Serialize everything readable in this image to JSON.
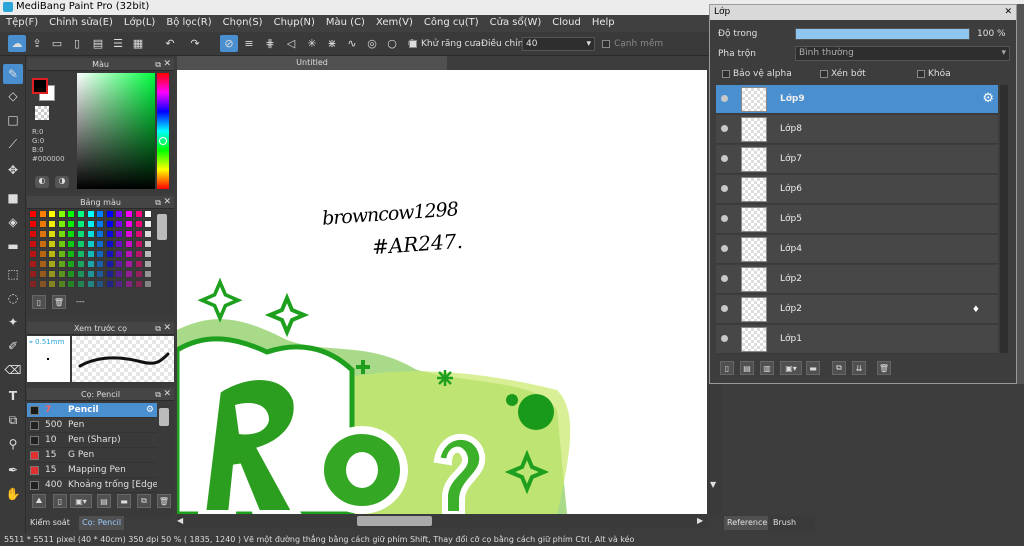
{
  "window": {
    "title": "MediBang Paint Pro (32bit)"
  },
  "menu": [
    "Tệp(F)",
    "Chỉnh sửa(E)",
    "Lớp(L)",
    "Bộ lọc(R)",
    "Chọn(S)",
    "Chụp(N)",
    "Màu (C)",
    "Xem(V)",
    "Công cụ(T)",
    "Cửa sổ(W)",
    "Cloud",
    "Help"
  ],
  "toolbar": {
    "antialias_label": "Khử răng cưa",
    "adjust_label": "Điều chỉnh",
    "adjust_value": "40",
    "snap_label": "Cạnh mềm"
  },
  "color_panel": {
    "title": "Màu",
    "r": "R:0",
    "g": "G:0",
    "b": "B:0",
    "hex": "#000000"
  },
  "palette_panel": {
    "title": "Bảng màu",
    "footer": "---"
  },
  "preview_panel": {
    "title": "Xem trước cọ",
    "size": "0.51mm"
  },
  "brush_panel": {
    "title": "Cọ: Pencil",
    "brushes": [
      {
        "size": "7",
        "name": "Pencil",
        "color": "#1a1a1a",
        "selected": true
      },
      {
        "size": "500",
        "name": "Pen",
        "color": "#222222"
      },
      {
        "size": "10",
        "name": "Pen (Sharp)",
        "color": "#222222"
      },
      {
        "size": "15",
        "name": "G Pen",
        "color": "#e03030"
      },
      {
        "size": "15",
        "name": "Mapping Pen",
        "color": "#e03030"
      },
      {
        "size": "400",
        "name": "Khoảng trống [Edge ]",
        "color": "#222222"
      }
    ],
    "tab1": "Kiểm soát cọ",
    "tab2": "Cọ: Pencil"
  },
  "canvas": {
    "tab_title": "Untitled",
    "signature1": "browncow1298",
    "signature2": "#AR247."
  },
  "layer_window": {
    "title": "Lớp",
    "opacity_label": "Độ trong",
    "opacity_value": "100 %",
    "opacity_fraction": 1.0,
    "blend_label": "Pha trộn",
    "blend_value": "Bình thường",
    "protect_alpha": "Bảo vệ alpha",
    "clipping": "Xén bớt",
    "lock": "Khóa",
    "layers": [
      "Lớp9",
      "Lớp8",
      "Lớp7",
      "Lớp6",
      "Lớp5",
      "Lớp4",
      "Lớp2",
      "Lớp2",
      "Lớp1"
    ]
  },
  "right_tabs": {
    "reference": "Reference",
    "brush_size": "Brush Size"
  },
  "status": {
    "text": "5511 * 5511 pixel   (40 * 40cm)   350 dpi   50 %   ( 1835, 1240 )   Vẽ một đường thẳng bằng cách giữ phím Shift, Thay đổi cỡ cọ bằng cách giữ phím Ctrl, Alt và kéo"
  },
  "colors": {
    "accent": "#4a8fd0",
    "panel": "#3a3a3a",
    "green": "#1ea01e"
  }
}
